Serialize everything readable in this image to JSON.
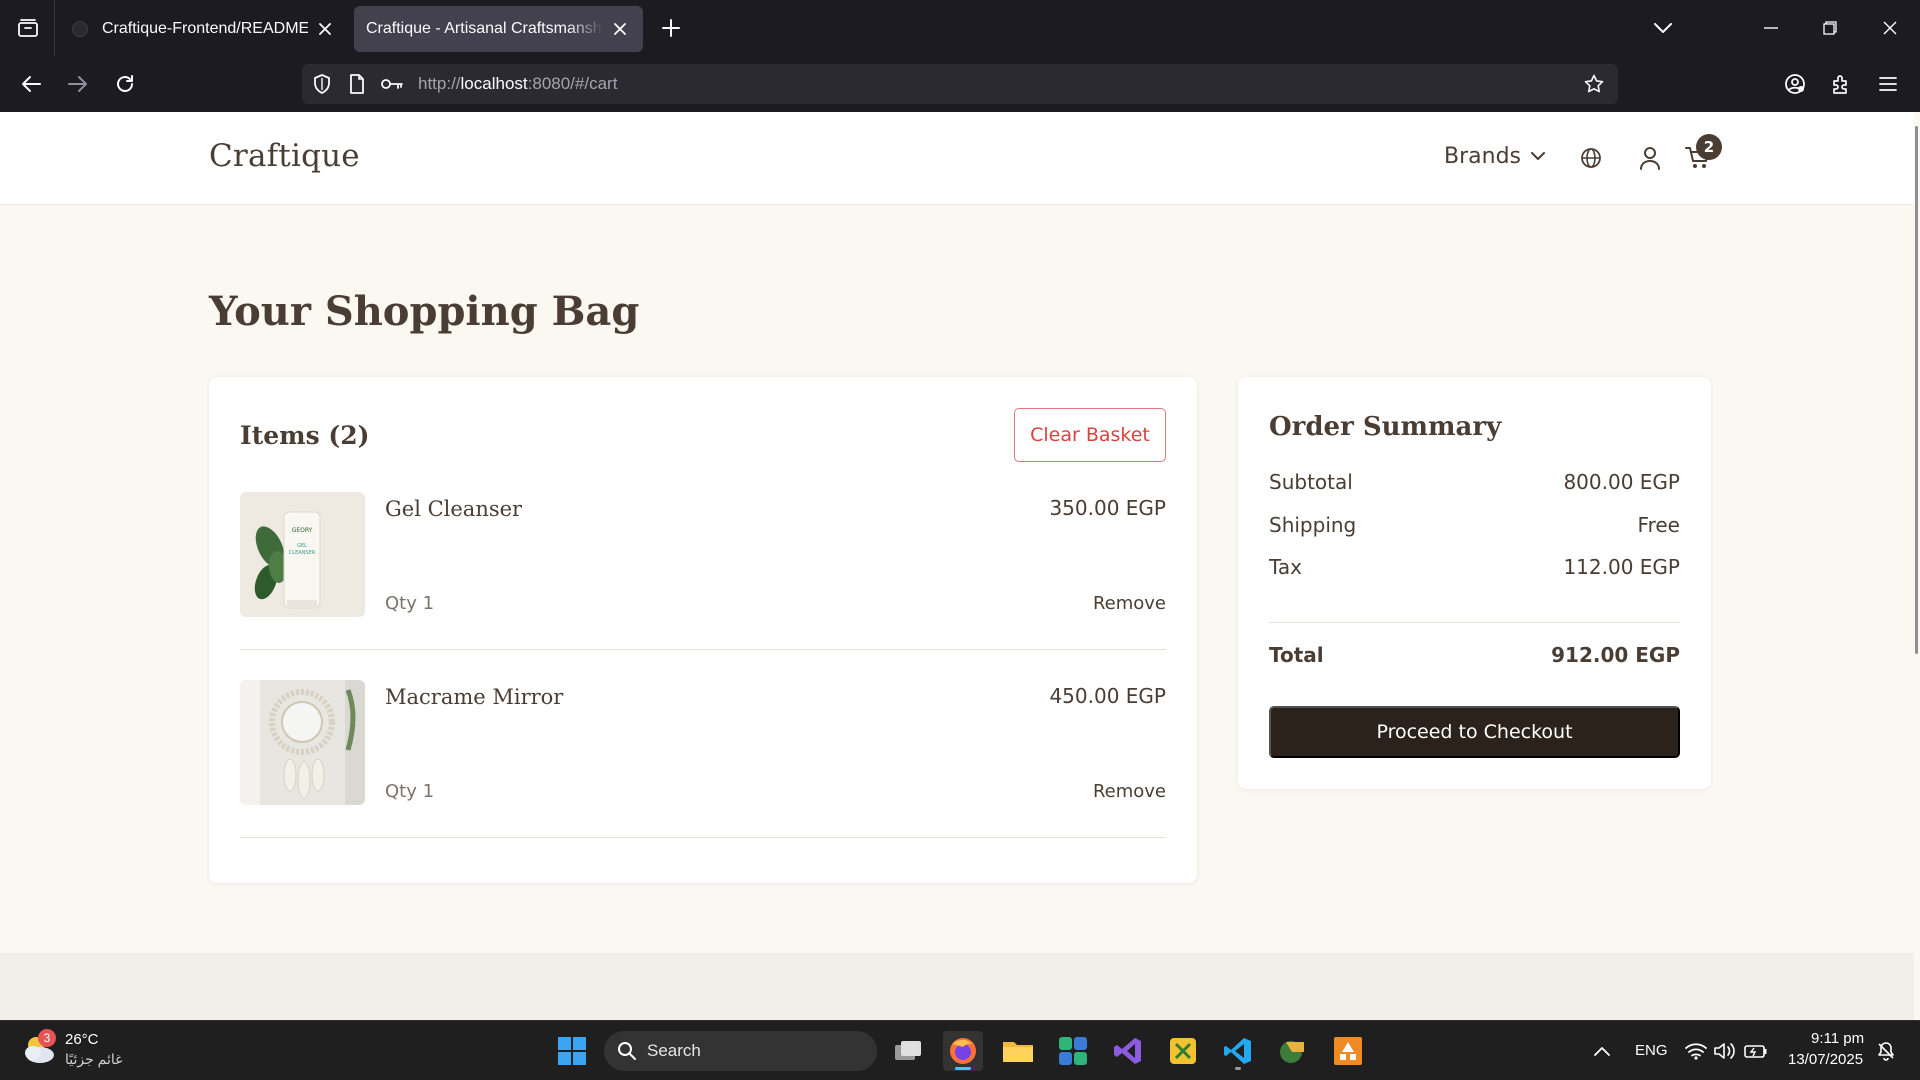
{
  "browser": {
    "tabs": [
      {
        "title": "Craftique-Frontend/README.md",
        "active": false
      },
      {
        "title": "Craftique - Artisanal Craftsmanship for",
        "active": true
      }
    ],
    "url": {
      "scheme": "http://",
      "host": "localhost",
      "rest": ":8080/#/cart"
    }
  },
  "site": {
    "logo": "Craftique",
    "nav": {
      "brands_label": "Brands"
    },
    "cart_count": "2"
  },
  "cart": {
    "page_title": "Your Shopping Bag",
    "items_heading": "Items (2)",
    "clear_label": "Clear Basket",
    "items": [
      {
        "name": "Gel Cleanser",
        "price": "350.00 EGP",
        "qty": "Qty 1",
        "remove": "Remove",
        "image": "cleanser-tube-image",
        "image_text": [
          "GEORY",
          "GEL",
          "CLEANSER"
        ]
      },
      {
        "name": "Macrame Mirror",
        "price": "450.00 EGP",
        "qty": "Qty 1",
        "remove": "Remove",
        "image": "macrame-mirror-image"
      }
    ]
  },
  "summary": {
    "heading": "Order Summary",
    "rows": [
      {
        "label": "Subtotal",
        "value": "800.00 EGP"
      },
      {
        "label": "Shipping",
        "value": "Free"
      },
      {
        "label": "Tax",
        "value": "112.00 EGP"
      }
    ],
    "total": {
      "label": "Total",
      "value": "912.00 EGP"
    },
    "checkout_label": "Proceed to Checkout"
  },
  "taskbar": {
    "weather": {
      "temp": "26°C",
      "condition": "غائم جزئيًا",
      "badge": "3"
    },
    "search_label": "Search",
    "language": "ENG",
    "time": "9:11 pm",
    "date": "13/07/2025"
  },
  "colors": {
    "brand_text": "#4a3d33",
    "page_bg": "#fbf7f1",
    "checkout_bg": "#2b221b",
    "clear_text": "#d9423f"
  }
}
